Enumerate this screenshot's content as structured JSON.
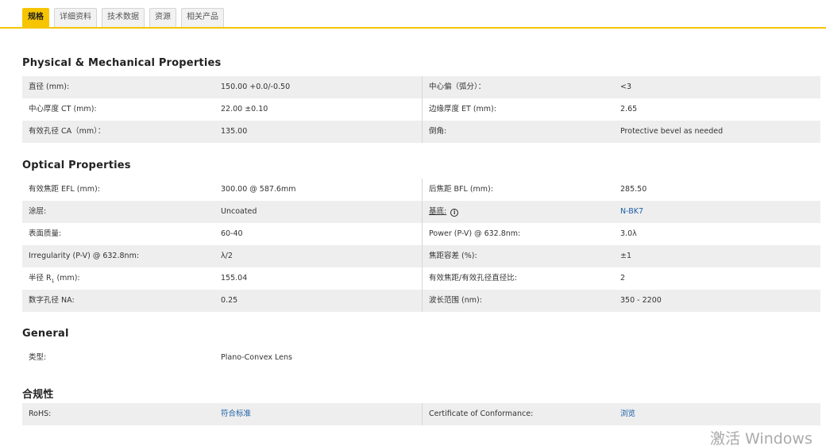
{
  "tabs": [
    "规格",
    "详细资料",
    "技术数据",
    "资源",
    "相关产品"
  ],
  "sections": {
    "physical": {
      "title": "Physical & Mechanical Properties",
      "rows": [
        {
          "l1": "直径 (mm):",
          "v1": "150.00 +0.0/-0.50",
          "l2": "中心偏（弧分）：",
          "v2": "<3"
        },
        {
          "l1": "中心厚度 CT (mm):",
          "v1": "22.00 ±0.10",
          "l2": "边缘厚度 ET (mm):",
          "v2": "2.65"
        },
        {
          "l1": "有效孔径 CA（mm）：",
          "v1": "135.00",
          "l2": "倒角:",
          "v2": "Protective bevel as needed"
        }
      ]
    },
    "optical": {
      "title": "Optical Properties",
      "rows": [
        {
          "l1": "有效焦距 EFL (mm):",
          "v1": "300.00 @ 587.6mm",
          "l2": "后焦距 BFL (mm):",
          "v2": "285.50"
        },
        {
          "l1": "涂层:",
          "v1": "Uncoated",
          "l2": "基底:",
          "v2": "N-BK7"
        },
        {
          "l1": "表面质量:",
          "v1": "60-40",
          "l2": "Power (P-V) @ 632.8nm:",
          "v2": "3.0λ"
        },
        {
          "l1": "Irregularity (P-V) @ 632.8nm:",
          "v1": "λ/2",
          "l2": "焦距容差 (%):",
          "v2": "±1"
        },
        {
          "l1": "半径 R",
          "l1_sub": "1",
          "l1_suffix": " (mm):",
          "v1": "155.04",
          "l2": "有效焦距/有效孔径直径比:",
          "v2": "2"
        },
        {
          "l1": "数字孔径 NA:",
          "v1": "0.25",
          "l2": "波长范围 (nm):",
          "v2": "350 - 2200"
        }
      ]
    },
    "general": {
      "title": "General",
      "rows": [
        {
          "l1": "类型:",
          "v1": "Plano-Convex Lens"
        }
      ]
    },
    "compliance": {
      "title": "合规性",
      "rows": [
        {
          "l1": "RoHS:",
          "v1": "符合标准",
          "l2": "Certificate of Conformance:",
          "v2": "浏览"
        }
      ]
    }
  },
  "info_icon_glyph": "i",
  "watermark": "激活 Windows",
  "colors": {
    "accent": "#f7c500",
    "link": "#1d5fa8",
    "row_shade": "#eeeeee"
  }
}
